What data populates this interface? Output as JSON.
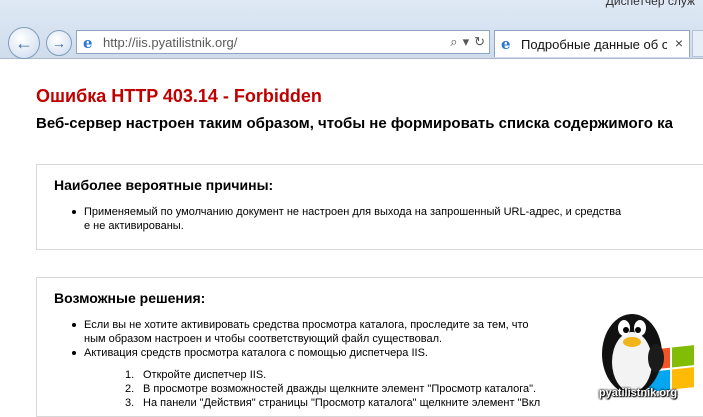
{
  "browser": {
    "corner_text": "Диспетчер служ",
    "back_label": "←",
    "forward_label": "→",
    "address_url": "http://iis.pyatilistnik.org/",
    "address_tools": {
      "search": "⌕",
      "dropdown": "▾",
      "refresh": "↻"
    },
    "tab_title": "Подробные данные об о...",
    "tab_close": "×"
  },
  "page": {
    "error_title": "Ошибка HTTP 403.14 - Forbidden",
    "error_subtitle": "Веб-сервер настроен таким образом, чтобы не формировать списка содержимого ка",
    "causes": {
      "heading": "Наиболее вероятные причины:",
      "items": [
        {
          "line1": "Применяемый по умолчанию документ не настроен для выхода на запрошенный URL-адрес, и средства",
          "line2": "е не активированы."
        }
      ]
    },
    "solutions": {
      "heading": "Возможные решения:",
      "items": [
        {
          "line1": "Если вы не хотите активировать средства просмотра каталога, проследите за тем, что",
          "line2": "ным образом настроен и чтобы соответствующий файл существовал."
        },
        {
          "line1": "Активация средств просмотра каталога с помощью диспетчера IIS."
        }
      ],
      "steps": [
        {
          "num": "1.",
          "text": "Откройте диспетчер IIS."
        },
        {
          "num": "2.",
          "text": "В просмотре возможностей дважды щелкните элемент \"Просмотр каталога\"."
        },
        {
          "num": "3.",
          "text": "На панели \"Действия\" страницы \"Просмотр каталога\" щелкните элемент \"Вкл"
        }
      ]
    }
  },
  "watermark": {
    "text": "pyatilistnik.org"
  },
  "colors": {
    "error_red": "#c00000",
    "chrome_bg": "#d6e2f0",
    "panel_border": "#d8d8d8"
  }
}
